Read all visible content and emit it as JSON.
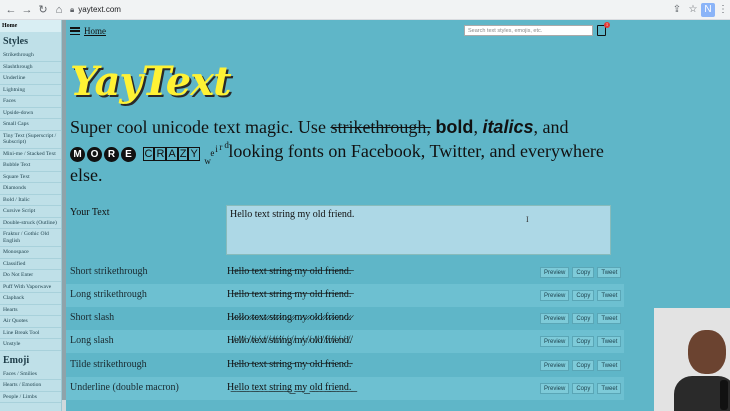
{
  "browser": {
    "url": "yaytext.com",
    "icons": [
      "back-arrow-icon",
      "forward-arrow-icon",
      "reload-icon",
      "home-icon",
      "lock-icon",
      "share-icon",
      "star-icon",
      "puzzle-icon",
      "profile-icon",
      "menu-dots-icon"
    ]
  },
  "sidebar": {
    "top_item": "Home",
    "styles_heading": "Styles",
    "items": [
      "Strikethrough",
      "Slashthrough",
      "Underline",
      "Lightning",
      "Faces",
      "Upside-down",
      "Small Caps",
      "Tiny Text (Superscript / Subscript)",
      "Mini-me / Stacked Text",
      "Bubble Text",
      "Square Text",
      "Diamonds",
      "Bold / Italic",
      "Cursive Script",
      "Double-struck (Outline)",
      "Fraktur / Gothic Old English",
      "Monospace",
      "Classified",
      "Do Not Enter",
      "Puff With Vaporwave",
      "Clapback",
      "Hearts",
      "Air Quotes",
      "Line Break Tool",
      "Unstyle"
    ],
    "emoji_heading": "Emoji",
    "emoji_items": [
      "Faces / Smilies",
      "Hearts / Emotion",
      "People / Limbs"
    ]
  },
  "header": {
    "home_label": "Home",
    "search_placeholder": "Search text styles, emojis, etc.",
    "cart_badge": "1"
  },
  "hero": {
    "logo": "YayText",
    "tag_1": "Super cool unicode text magic. Use ",
    "tag_strike": "strikethrough,",
    "tag_bold": "bold",
    "tag_comma": ", ",
    "tag_italic": "italics",
    "tag_and": ", and",
    "tag_more": [
      "M",
      "O",
      "R",
      "E"
    ],
    "tag_crazy": [
      "C",
      "R",
      "A",
      "Z",
      "Y"
    ],
    "tag_weird": [
      "w",
      "e",
      "i",
      "r",
      "d"
    ],
    "tag_2": "looking fonts on Facebook, Twitter, and everywhere else."
  },
  "input": {
    "label": "Your Text",
    "value": "Hello text string my old friend."
  },
  "results": [
    {
      "name": "Short strikethrough",
      "value": "H̶e̶l̶l̶o̶ ̶t̶e̶x̶t̶ ̶s̶t̶r̶i̶n̶g̶ ̶m̶y̶ ̶o̶l̶d̶ ̶f̶r̶i̶e̶n̶d̶.̶"
    },
    {
      "name": "Long strikethrough",
      "value": "H̶e̶l̶l̶o̶ ̶t̶e̶x̶t̶ ̶s̶t̶r̶i̶n̶g̶ ̶m̶y̶ ̶o̶l̶d̶ ̶f̶r̶i̶e̶n̶d̶.̶"
    },
    {
      "name": "Short slash",
      "value": "H̷e̷l̷l̷o̷ ̷t̷e̷x̷t̷ ̷s̷t̷r̷i̷n̷g̷ ̷m̷y̷ ̷o̷l̷d̷ ̷f̷r̷i̷e̷n̷d̷.̷"
    },
    {
      "name": "Long slash",
      "value": "H̸e̸l̸l̸o̸ ̸t̸e̸x̸t̸ ̸s̸t̸r̸i̸n̸g̸ ̸m̸y̸ ̸o̸l̸d̸ ̸f̸r̸i̸e̸n̸d̸.̸"
    },
    {
      "name": "Tilde strikethrough",
      "value": "H̴e̴l̴l̴o̴ ̴t̴e̴x̴t̴ ̴s̴t̴r̴i̴n̴g̴ ̴m̴y̴ ̴o̴l̴d̴ ̴f̴r̴i̴e̴n̴d̴.̴"
    },
    {
      "name": "Underline (double macron)",
      "value": "H͟e͟l͟l͟o͟ ͟t͟e͟x͟t͟ ͟s͟t͟r͟i͟n͟g͟ ͟m͟y͟ ͟o͟l͟d͟ ͟f͟r͟i͟e͟n͟d͟.͟"
    }
  ],
  "row_buttons": {
    "preview": "Preview",
    "copy": "Copy",
    "tweet": "Tweet"
  },
  "colors": {
    "page": "#5fb6c8",
    "sidebar": "#bfe0e8",
    "logo": "#fff234",
    "input": "#add8e6"
  }
}
